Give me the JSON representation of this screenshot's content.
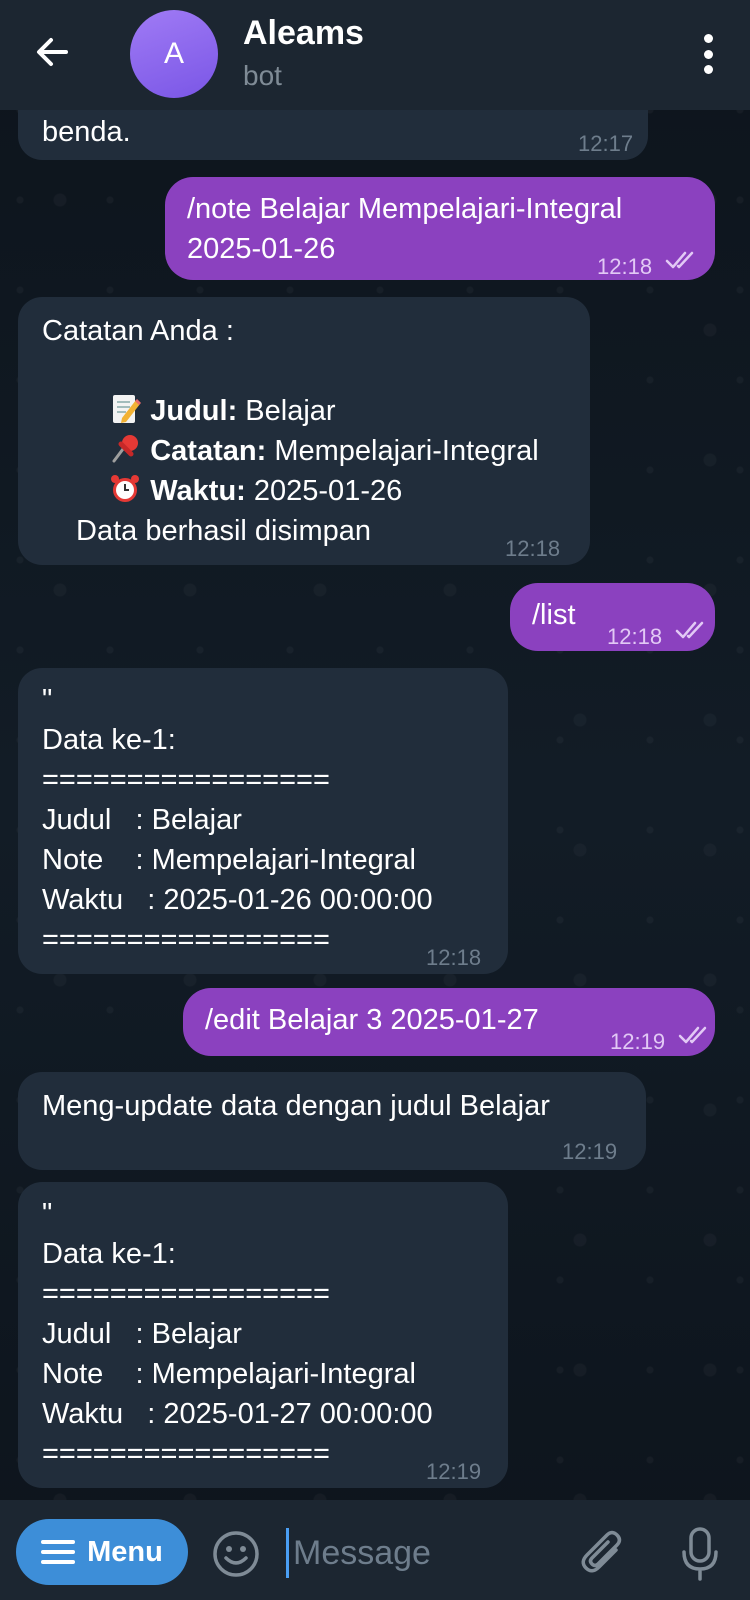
{
  "header": {
    "avatar_letter": "A",
    "title": "Aleams",
    "subtitle": "bot"
  },
  "messages": [
    {
      "direction": "in",
      "text": "benda.",
      "time": "12:17"
    },
    {
      "direction": "out",
      "line1": "/note Belajar Mempelajari-Integral",
      "line2": "2025-01-26",
      "time": "12:18"
    },
    {
      "direction": "in",
      "header": "Catatan Anda :",
      "fields": [
        {
          "icon": "memo-icon",
          "label": "Judul:",
          "value": "Belajar"
        },
        {
          "icon": "pushpin-icon",
          "label": "Catatan:",
          "value": "Mempelajari-Integral"
        },
        {
          "icon": "alarm-clock-icon",
          "label": "Waktu:",
          "value": "2025-01-26"
        }
      ],
      "footer": "Data berhasil disimpan",
      "time": "12:18"
    },
    {
      "direction": "out",
      "text": "/list",
      "time": "12:18"
    },
    {
      "direction": "in",
      "lines": [
        "\"",
        "Data ke-1:",
        "=================",
        "Judul   : Belajar",
        "Note    : Mempelajari-Integral",
        "Waktu   : 2025-01-26 00:00:00",
        "================="
      ],
      "time": "12:18"
    },
    {
      "direction": "out",
      "text": "/edit Belajar 3 2025-01-27",
      "time": "12:19"
    },
    {
      "direction": "in",
      "text": "Meng-update data dengan judul Belajar",
      "time": "12:19"
    },
    {
      "direction": "in",
      "lines": [
        "\"",
        "Data ke-1:",
        "=================",
        "Judul   : Belajar",
        "Note    : Mempelajari-Integral",
        "Waktu   : 2025-01-27 00:00:00",
        "================="
      ],
      "time": "12:19"
    }
  ],
  "input": {
    "menu_label": "Menu",
    "placeholder": "Message"
  },
  "colors": {
    "outgoing_bubble": "#8b41bf",
    "incoming_bubble": "#212d3b",
    "menu_button": "#3d8ed8"
  }
}
